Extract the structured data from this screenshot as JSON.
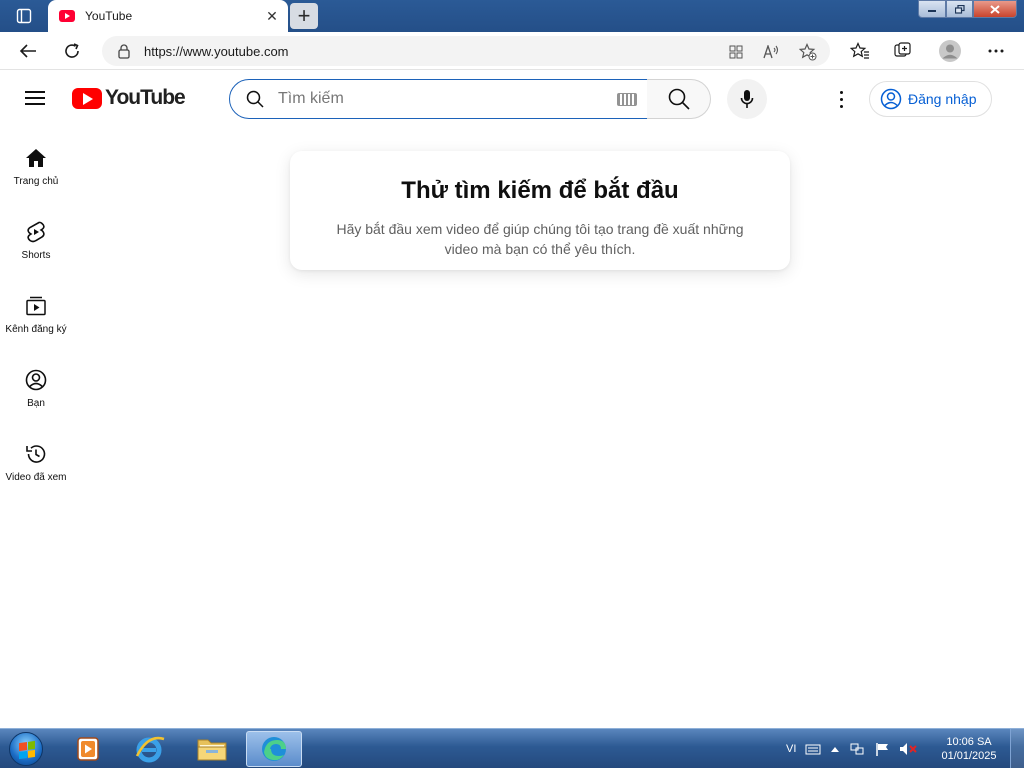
{
  "browser": {
    "tab": {
      "title": "YouTube",
      "close": "✕"
    },
    "new_tab": "+",
    "address": {
      "url": "https://www.youtube.com"
    }
  },
  "header": {
    "logo_text": "YouTube",
    "search_placeholder": "Tìm kiếm",
    "signin_label": "Đăng nhập"
  },
  "guide": {
    "items": [
      {
        "label": "Trang chủ",
        "icon": "home-icon"
      },
      {
        "label": "Shorts",
        "icon": "shorts-icon"
      },
      {
        "label": "Kênh đăng ký",
        "icon": "subscriptions-icon"
      },
      {
        "label": "Bạn",
        "icon": "you-icon"
      },
      {
        "label": "Video đã xem",
        "icon": "history-icon"
      }
    ]
  },
  "empty_state": {
    "title": "Thử tìm kiếm để bắt đầu",
    "body": "Hãy bắt đầu xem video để giúp chúng tôi tạo trang đề xuất những video mà bạn có thể yêu thích."
  },
  "taskbar": {
    "language": "VI",
    "time": "10:06 SA",
    "date": "01/01/2025"
  },
  "colors": {
    "youtube_red": "#ff0000",
    "link_blue": "#065fd4",
    "search_focus_border": "#1c62b9"
  }
}
